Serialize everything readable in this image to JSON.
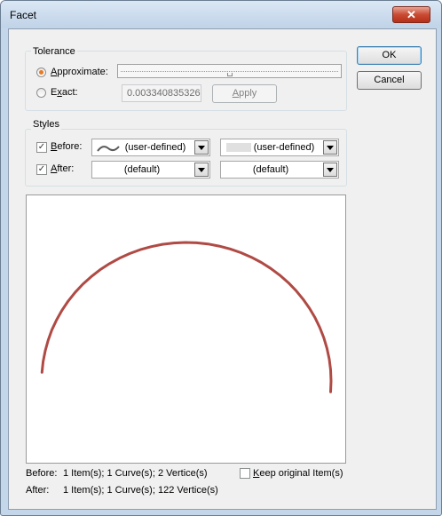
{
  "window": {
    "title": "Facet",
    "close_glyph": "✕"
  },
  "tolerance": {
    "label": "Tolerance",
    "approximate_label": "Approximate:",
    "approximate_selected": true,
    "exact_label": "Exact:",
    "exact_value": "0.003340835326",
    "apply_label": "Apply",
    "slider_level": 0.5
  },
  "styles": {
    "label": "Styles",
    "before_label": "Before:",
    "before_checked": true,
    "before_style": "(user-defined)",
    "before_color": "(user-defined)",
    "after_label": "After:",
    "after_checked": true,
    "after_style": "(default)",
    "after_color": "(default)"
  },
  "buttons": {
    "ok": "OK",
    "cancel": "Cancel"
  },
  "preview": {
    "curve_color": "#b04a44"
  },
  "footer": {
    "before_label": "Before:",
    "before_value": "1 Item(s); 1 Curve(s); 2 Vertice(s)",
    "after_label": "After:",
    "after_value": "1 Item(s); 1 Curve(s); 122 Vertice(s)",
    "keep_label": "Keep original Item(s)",
    "keep_checked": false
  },
  "icons": {
    "check": "✓",
    "wave": "wave-line-icon"
  }
}
